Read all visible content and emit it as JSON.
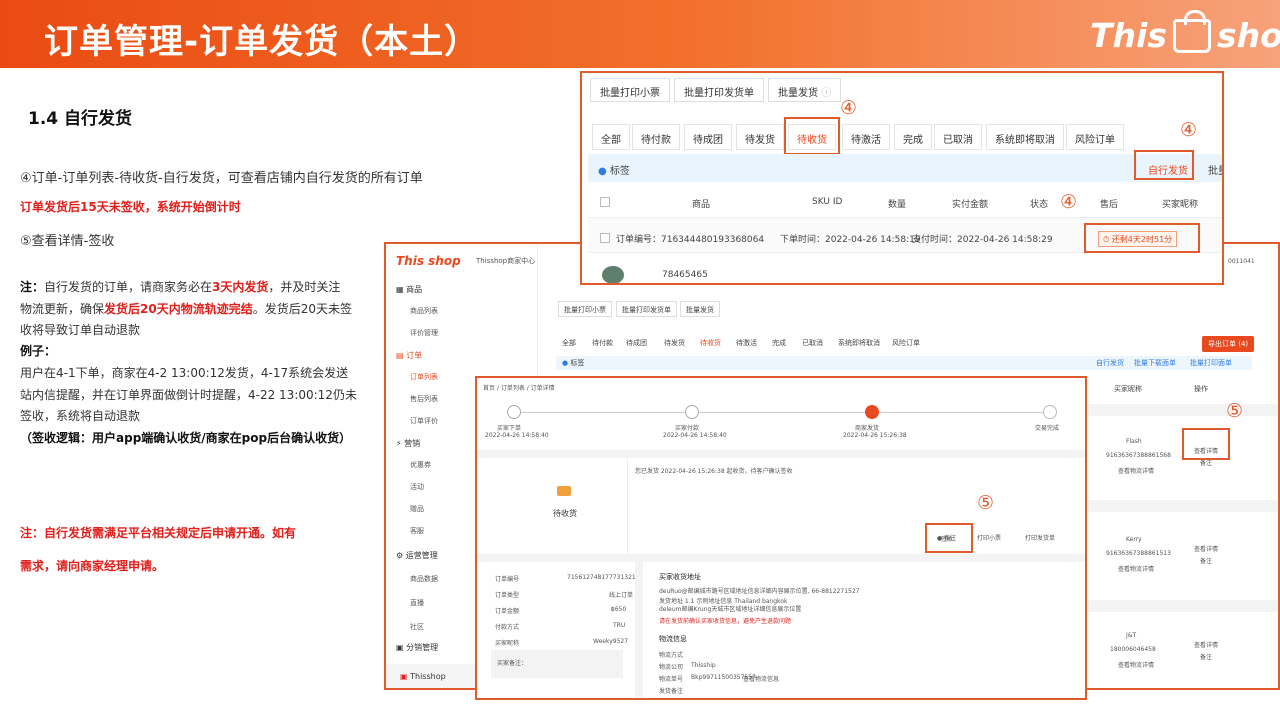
{
  "header": {
    "title": "订单管理-订单发货（本土）",
    "logo_left": "This",
    "logo_right": "shop"
  },
  "left": {
    "section": "1.4 自行发货",
    "line1": "④订单-订单列表-待收货-自行发货，可查看店铺内自行发货的所有订单",
    "line2": "订单发货后15天未签收，系统开始倒计时",
    "line3": "⑤查看详情-签收",
    "note_a1": "注：",
    "note_a2": "自行发货的订单，请商家务必在",
    "note_a3": "3天内发货",
    "note_a4": "，并及时关注",
    "note_b1": "物流更新，确保",
    "note_b2": "发货后20天内物流轨迹完结",
    "note_b3": "。发货后20天未签",
    "note_c": "收将导致订单自动退款",
    "ex_title": "例子：",
    "ex1": "用户在4-1下单，商家在4-2 13:00:12发货，4-17系统会发送",
    "ex2": "站内信提醒，并在订单界面做倒计时提醒，4-22 13:00:12仍未",
    "ex3": "签收，系统将自动退款",
    "ex4": "（签收逻辑：用户app端确认收货/商家在pop后台确认收货）",
    "warn1": "注：自行发货需满足平台相关规定后申请开通。如有",
    "warn2": "需求，请向商家经理申请。"
  },
  "top": {
    "buttons": [
      "批量打印小票",
      "批量打印发货单",
      "批量发货"
    ],
    "tabs": [
      "全部",
      "待付款",
      "待成团",
      "待发货",
      "待收货",
      "待激活",
      "完成",
      "已取消",
      "系统即将取消",
      "风险订单"
    ],
    "label": "标签",
    "self_ship": "自行发货",
    "batch": "批量",
    "cols": [
      "商品",
      "SKU ID",
      "数量",
      "实付金额",
      "状态",
      "售后",
      "买家昵称"
    ],
    "order_no": "订单编号：716344480193368064",
    "order_time": "下单时间：2022-04-26 14:58:19",
    "pay_time": "支付时间：2022-04-26 14:58:29",
    "countdown": "还剩4天2时51分",
    "product_id": "78465465",
    "circles": [
      "④",
      "④",
      "④"
    ]
  },
  "big": {
    "logo": "This shop",
    "center": "Thisshop商家中心",
    "right_num": "0011041",
    "groups": [
      {
        "name": "商品",
        "items": [
          "商品列表",
          "评价管理"
        ]
      },
      {
        "name": "订单",
        "items": [
          "订单列表",
          "售后列表",
          "订单评价"
        ]
      },
      {
        "name": "营销",
        "items": [
          "优惠券",
          "活动",
          "赠品",
          "客服"
        ]
      },
      {
        "name": "运营管理",
        "items": [
          "商品数据",
          "直播",
          "社区"
        ]
      },
      {
        "name": "分销管理",
        "items": []
      }
    ],
    "bottom": "Thisshop",
    "buttons": [
      "批量打印小票",
      "批量打印发货单",
      "批量发货"
    ],
    "tabs": [
      "全部",
      "待付款",
      "待成团",
      "待发货",
      "待收货",
      "待激活",
      "完成",
      "已取消",
      "系统即将取消",
      "风险订单"
    ],
    "export": "导出订单 (4)",
    "label": "标签",
    "links": [
      "自行发货",
      "批量下载面单",
      "批量打印面单"
    ],
    "col_buyer": "买家昵称",
    "col_op": "操作",
    "rows": [
      {
        "name": "Flash",
        "id": "91636367388861568",
        "link": "查看物流详情",
        "op": "查看详情",
        "op2": "备注"
      },
      {
        "name": "Kerry",
        "id": "91636367388861513",
        "link": "查看物流详情",
        "op": "查看详情",
        "op2": "备注"
      },
      {
        "name": "J&T",
        "id": "180006046458",
        "link": "查看物流详情",
        "op": "查看详情",
        "op2": "备注"
      }
    ],
    "circle": "⑤"
  },
  "detail": {
    "crumb": "首页 / 订单列表 / 订单详情",
    "steps": [
      {
        "label": "买家下单",
        "time": "2022-04-26 14:58:40"
      },
      {
        "label": "买家付款",
        "time": "2022-04-26 14:58:40"
      },
      {
        "label": "商家发货",
        "time": "2022-04-26 15:26:38"
      },
      {
        "label": "交易完成",
        "time": ""
      }
    ],
    "status": "待收货",
    "msg": "您已发货 2022-04-26 15:26:38 起收货，待客户确认签收",
    "actions": [
      "签收",
      "备注",
      "打印小票",
      "打印发货单"
    ],
    "circle": "⑤",
    "info": [
      {
        "k": "订单编号",
        "v": "715612748177731321"
      },
      {
        "k": "订单类型",
        "v": "线上订单"
      },
      {
        "k": "订单金额",
        "v": "฿650"
      },
      {
        "k": "付款方式",
        "v": "TRU"
      },
      {
        "k": "买家昵称",
        "v": "Weeky9527"
      }
    ],
    "remark": "买家备注：",
    "addr_title": "买家收货地址",
    "addr1": "deuRuo@邮编城市路号区域地址信息详细内容展示位置, 66-8812271527",
    "addr2": "发货地址 1.1 示例地址信息 Thailand bangkok",
    "addr3": "deleum邮编Krung天城市区域地址详细信息展示位置",
    "addr_warn": "请在发货前确认买家收货信息，避免产生退款问题",
    "log_title": "物流信息",
    "log": [
      {
        "k": "物流方式",
        "v": ""
      },
      {
        "k": "物流公司",
        "v": "Thisship"
      },
      {
        "k": "物流单号",
        "v": "Bkp99711500357557"
      },
      {
        "k": "发货备注",
        "v": ""
      }
    ],
    "log_link": "查看物流信息"
  }
}
